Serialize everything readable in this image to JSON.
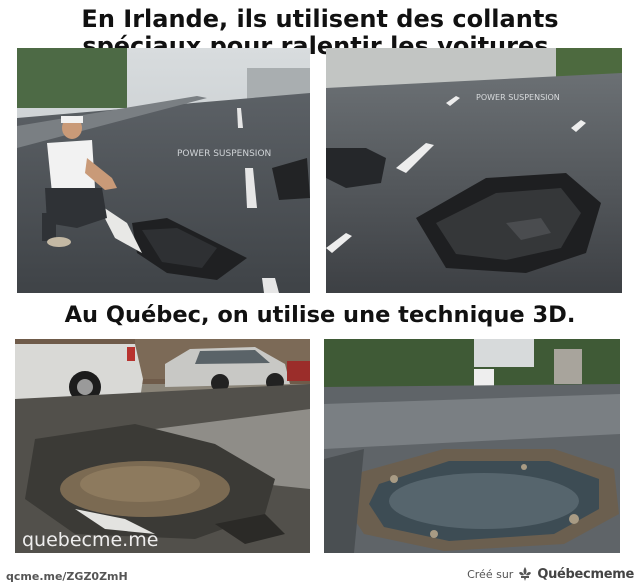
{
  "captions": {
    "top_line1": "En Irlande, ils utilisent des collants",
    "top_line2": "spéciaux pour ralentir les voitures.",
    "middle": "Au Québec, on utilise une technique 3D."
  },
  "photos": {
    "road_sign_text": "POWER SUSPENSION",
    "watermark": "quebecme.me"
  },
  "footer": {
    "short_link": "qcme.me/ZGZ0ZmH",
    "created_on": "Créé sur",
    "brand": "Québecmeme"
  }
}
